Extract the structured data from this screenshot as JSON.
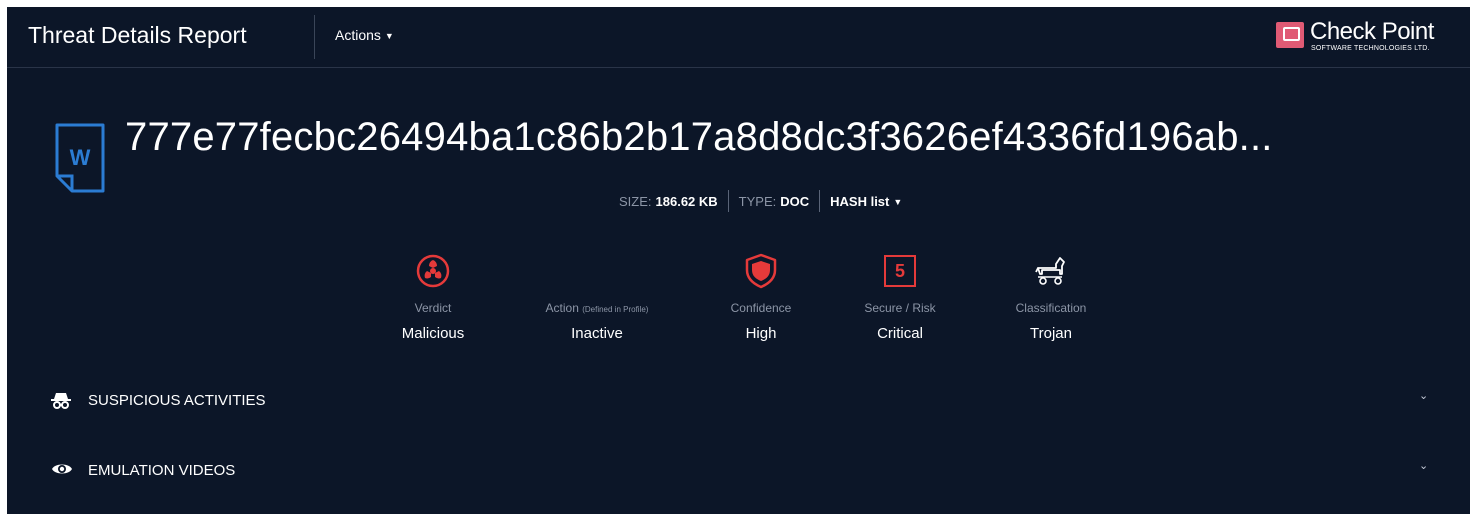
{
  "header": {
    "title": "Threat Details Report",
    "actions_label": "Actions",
    "brand": {
      "name": "Check Point",
      "sub": "SOFTWARE TECHNOLOGIES LTD."
    }
  },
  "file": {
    "icon": "word-document-icon",
    "icon_letter": "W",
    "hash": "777e77fecbc26494ba1c86b2b17a8d8dc3f3626ef4336fd196ab...",
    "size_label": "SIZE:",
    "size_value": "186.62 KB",
    "type_label": "TYPE:",
    "type_value": "DOC",
    "hash_list_label": "HASH list"
  },
  "stats": [
    {
      "icon": "biohazard-icon",
      "label": "Verdict",
      "value": "Malicious"
    },
    {
      "label": "Action",
      "label_note": "(Defined in Profile)",
      "value": "Inactive"
    },
    {
      "icon": "shield-icon",
      "label": "Confidence",
      "value": "High"
    },
    {
      "risk_number": "5",
      "label": "Secure / Risk",
      "value": "Critical"
    },
    {
      "icon": "trojan-horse-icon",
      "label": "Classification",
      "value": "Trojan"
    }
  ],
  "sections": [
    {
      "icon": "spy-icon",
      "title": "SUSPICIOUS ACTIVITIES",
      "expanded": false
    },
    {
      "icon": "eye-icon",
      "title": "EMULATION VIDEOS",
      "expanded": false
    }
  ],
  "colors": {
    "background": "#0c1628",
    "danger": "#e53a3a",
    "accent_blue": "#2b7cd3",
    "muted_text": "#8c95a6",
    "brand_pink": "#e05a74"
  }
}
